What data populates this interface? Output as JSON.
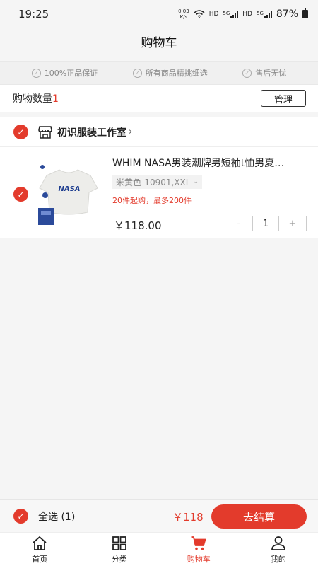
{
  "status": {
    "time": "19:25",
    "speed_value": "0.03",
    "speed_unit": "K/s",
    "hd1": "HD",
    "net1": "5G",
    "hd2": "HD",
    "net2": "5G",
    "battery": "87%"
  },
  "header": {
    "title": "购物车"
  },
  "guarantees": [
    {
      "label": "100%正品保证"
    },
    {
      "label": "所有商品精挑细选"
    },
    {
      "label": "售后无忧"
    }
  ],
  "cart": {
    "count_label": "购物数量",
    "count_value": "1",
    "manage_label": "管理"
  },
  "shop": {
    "name": "初识服装工作室",
    "items": [
      {
        "title": "WHIM NASA男装潮牌男短袖t恤男夏…",
        "spec": "米黄色-10901,XXL",
        "rule": "20件起购，最多200件",
        "price": "￥118.00",
        "minus": "-",
        "quantity": "1",
        "plus": "+",
        "image_text": "NASA"
      }
    ]
  },
  "checkout": {
    "select_all": "全选 (1)",
    "total": "￥118",
    "button": "去结算"
  },
  "tabs": [
    {
      "label": "首页",
      "icon": "home-icon"
    },
    {
      "label": "分类",
      "icon": "grid-icon"
    },
    {
      "label": "购物车",
      "icon": "cart-icon",
      "active": true
    },
    {
      "label": "我的",
      "icon": "user-icon"
    }
  ],
  "colors": {
    "accent": "#e33b2c",
    "background": "#f5f5f5"
  }
}
